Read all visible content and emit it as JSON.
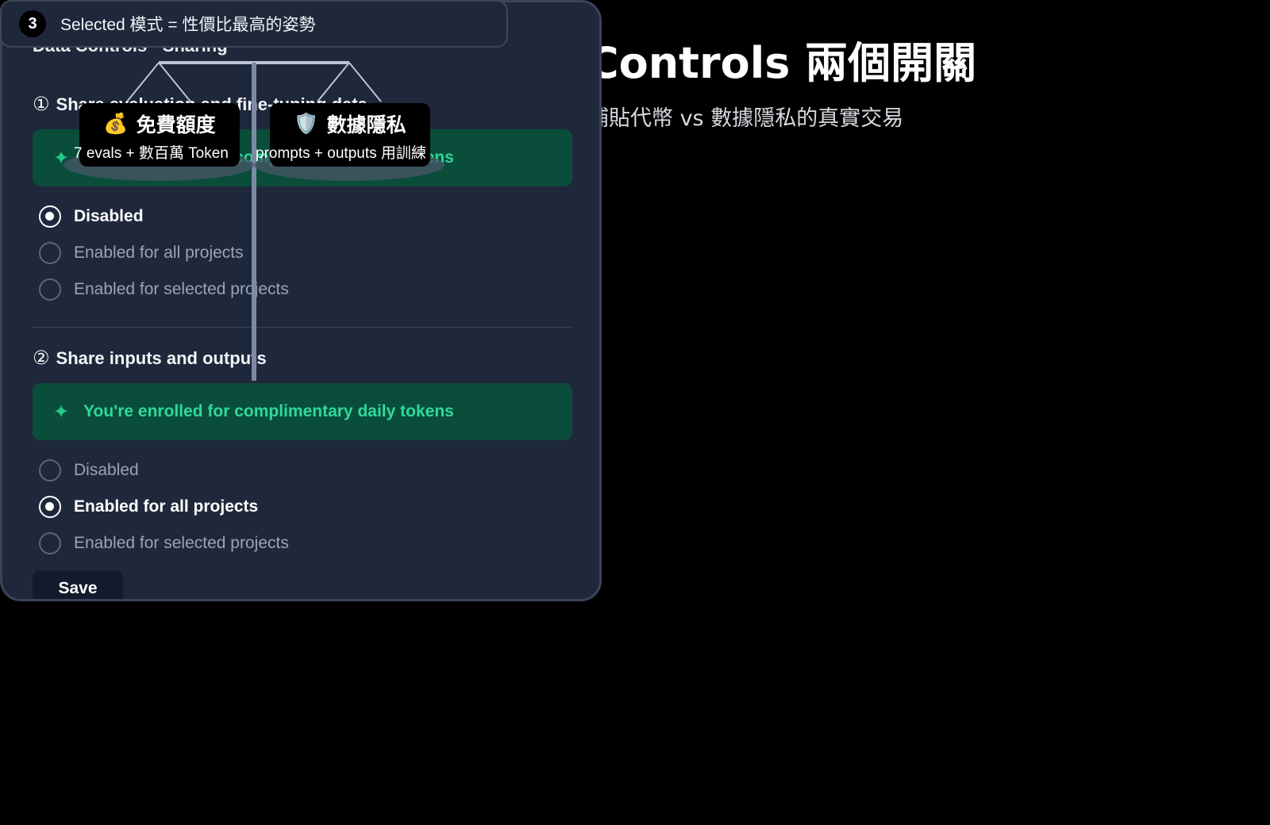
{
  "slide": {
    "title": "Controls 兩個開關",
    "subtitle": "補貼代幣 vs 數據隱私的真實交易"
  },
  "step": {
    "number": "3",
    "text": "Selected 模式 = 性價比最高的姿勢"
  },
  "panel": {
    "title": "Data Controls · Sharing",
    "section1": {
      "number": "①",
      "title": "Share evaluation and fine-tuning data",
      "banner": "You're enrolled for complimentary daily tokens",
      "options": [
        {
          "label": "Disabled",
          "selected": true
        },
        {
          "label": "Enabled for all projects",
          "selected": false
        },
        {
          "label": "Enabled for selected projects",
          "selected": false
        }
      ]
    },
    "section2": {
      "number": "②",
      "title": "Share inputs and outputs",
      "banner": "You're enrolled for complimentary daily tokens",
      "options": [
        {
          "label": "Disabled",
          "selected": false
        },
        {
          "label": "Enabled for all projects",
          "selected": true
        },
        {
          "label": "Enabled for selected projects",
          "selected": false
        }
      ]
    },
    "save_label": "Save"
  },
  "scale": {
    "left": {
      "icon": "money-bag-icon",
      "emoji": "💰",
      "title": "免費額度",
      "desc": "7 evals + 數百萬 Token"
    },
    "right": {
      "icon": "shield-icon",
      "emoji": "🛡️",
      "title": "數據隱私",
      "desc": "prompts + outputs 用訓練"
    }
  },
  "colors": {
    "panel_bg": "#1f283b",
    "banner_bg": "#0a4d3b",
    "banner_text": "#2fd99a",
    "page_bg": "#000000"
  }
}
